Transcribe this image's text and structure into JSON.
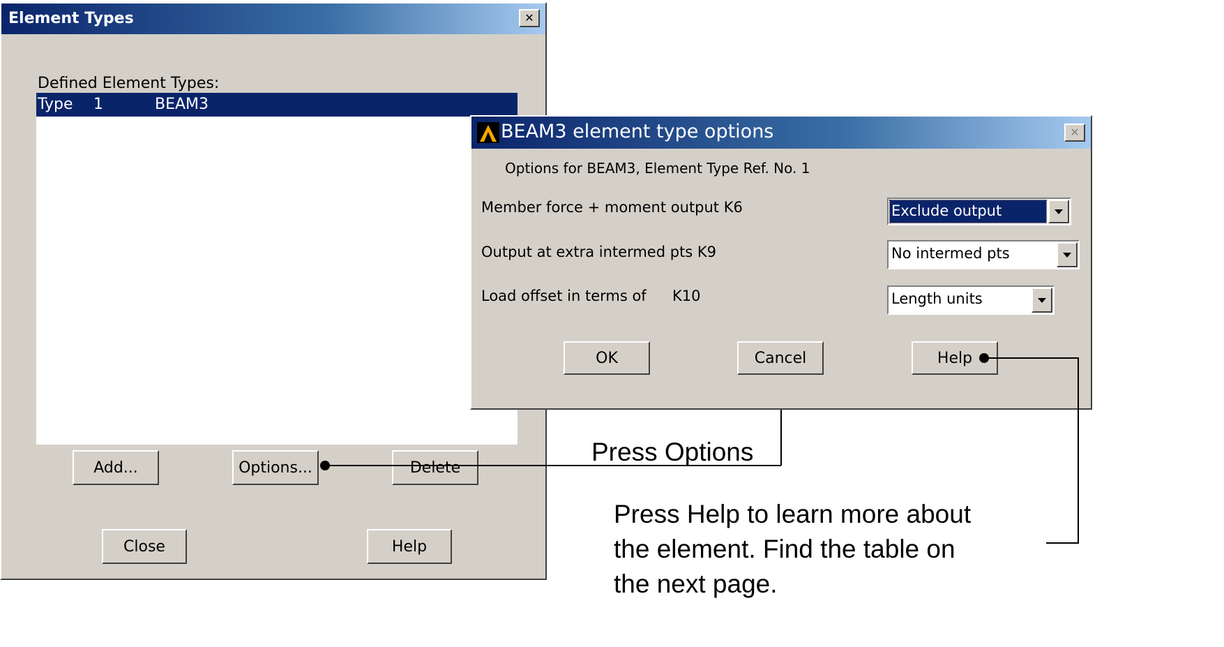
{
  "element_types_window": {
    "title": "Element Types",
    "close_glyph": "✕",
    "list_label": "Defined Element Types:",
    "list_items": [
      {
        "type_label": "Type",
        "number": "1",
        "name": "BEAM3"
      }
    ],
    "buttons": {
      "add": "Add...",
      "options": "Options...",
      "delete": "Delete",
      "close": "Close",
      "help": "Help"
    }
  },
  "options_window": {
    "title": "BEAM3 element type options",
    "logo_icon": "ansys-logo-icon",
    "close_glyph": "✕",
    "subtitle": "Options for BEAM3, Element Type Ref. No. 1",
    "rows": [
      {
        "label": "Member force + moment output  K6",
        "value": "Exclude output"
      },
      {
        "label": "Output at extra intermed pts  K9",
        "value": "No intermed pts"
      },
      {
        "label": "Load offset in terms of",
        "key": "K10",
        "value": "Length units"
      }
    ],
    "buttons": {
      "ok": "OK",
      "cancel": "Cancel",
      "help": "Help"
    }
  },
  "annotations": {
    "press_options": "Press Options",
    "press_help_lines": [
      "Press Help to learn more about",
      "the element. Find the table on",
      "the next page."
    ]
  },
  "colors": {
    "title_dark": "#0a246a",
    "title_light": "#a6caf0",
    "selection": "#0a246a",
    "dialog_bg": "#d4d0c8"
  }
}
